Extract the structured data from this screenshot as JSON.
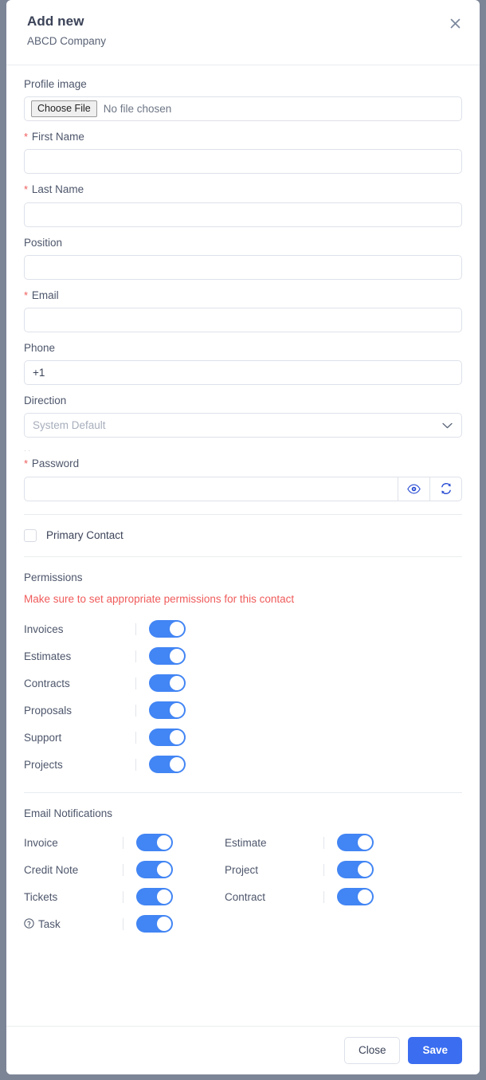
{
  "header": {
    "title": "Add new",
    "subtitle": "ABCD Company",
    "close_icon": "close-icon"
  },
  "form": {
    "profile_image": {
      "label": "Profile image",
      "button_label": "Choose File",
      "file_status": "No file chosen"
    },
    "first_name": {
      "label": "First Name",
      "required": true,
      "value": "",
      "placeholder": ""
    },
    "last_name": {
      "label": "Last Name",
      "required": true,
      "value": "",
      "placeholder": ""
    },
    "position": {
      "label": "Position",
      "required": false,
      "value": "",
      "placeholder": ""
    },
    "email": {
      "label": "Email",
      "required": true,
      "value": "",
      "placeholder": ""
    },
    "phone": {
      "label": "Phone",
      "required": false,
      "value": "+1",
      "placeholder": ""
    },
    "direction": {
      "label": "Direction",
      "selected": "System Default",
      "options": [
        "System Default"
      ],
      "chevron_icon": "chevron-down-icon"
    },
    "password": {
      "label": "Password",
      "required": true,
      "value": "",
      "reveal_icon": "eye-icon",
      "generate_icon": "refresh-icon"
    },
    "primary_contact": {
      "label": "Primary Contact",
      "checked": false
    }
  },
  "permissions": {
    "title": "Permissions",
    "warning": "Make sure to set appropriate permissions for this contact",
    "items": [
      {
        "label": "Invoices",
        "on": true
      },
      {
        "label": "Estimates",
        "on": true
      },
      {
        "label": "Contracts",
        "on": true
      },
      {
        "label": "Proposals",
        "on": true
      },
      {
        "label": "Support",
        "on": true
      },
      {
        "label": "Projects",
        "on": true
      }
    ]
  },
  "email_notifications": {
    "title": "Email Notifications",
    "left": [
      {
        "label": "Invoice",
        "on": true,
        "icon": null
      },
      {
        "label": "Credit Note",
        "on": true,
        "icon": null
      },
      {
        "label": "Tickets",
        "on": true,
        "icon": null
      },
      {
        "label": "Task",
        "on": true,
        "icon": "help-circle-icon"
      }
    ],
    "right": [
      {
        "label": "Estimate",
        "on": true
      },
      {
        "label": "Project",
        "on": true
      },
      {
        "label": "Contract",
        "on": true
      }
    ]
  },
  "footer": {
    "close_label": "Close",
    "save_label": "Save"
  },
  "colors": {
    "accent": "#3a6df0",
    "toggle_on": "#4285f4",
    "danger": "#f05b5b",
    "page_background": "#7c8596",
    "text": "#3b4358",
    "border": "#dde1e9"
  }
}
